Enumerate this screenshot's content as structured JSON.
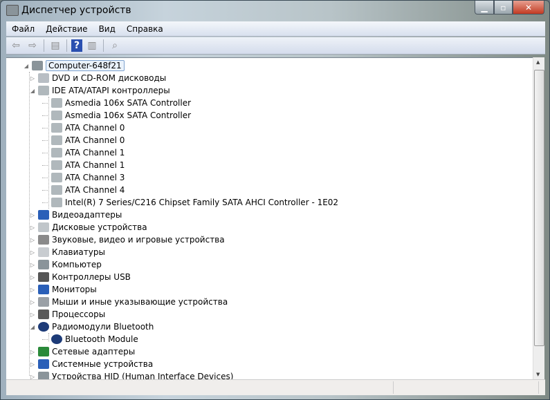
{
  "window": {
    "title": "Диспетчер устройств",
    "minimize": "▁",
    "maximize": "▫",
    "close": "✕"
  },
  "menu": [
    {
      "label": "Файл"
    },
    {
      "label": "Действие"
    },
    {
      "label": "Вид"
    },
    {
      "label": "Справка"
    }
  ],
  "toolbar": [
    {
      "name": "back-icon",
      "glyph": "⇦"
    },
    {
      "name": "forward-icon",
      "glyph": "⇨"
    },
    {
      "name": "sep"
    },
    {
      "name": "show-hide-console-tree-icon",
      "glyph": "▤"
    },
    {
      "name": "sep"
    },
    {
      "name": "help-icon",
      "glyph": "?"
    },
    {
      "name": "show-action-pane-icon",
      "glyph": "▥"
    },
    {
      "name": "sep"
    },
    {
      "name": "scan-hardware-icon",
      "glyph": "⌕"
    }
  ],
  "tree": [
    {
      "label": "Computer-648f21",
      "level": 0,
      "expanded": true,
      "icon": "computer-icon",
      "selected": true
    },
    {
      "label": "DVD и CD-ROM дисководы",
      "level": 1,
      "expanded": false,
      "icon": "dvd-drive-icon"
    },
    {
      "label": "IDE ATA/ATAPI контроллеры",
      "level": 1,
      "expanded": true,
      "icon": "ide-controller-icon"
    },
    {
      "label": "Asmedia 106x SATA Controller",
      "level": 2,
      "icon": "ide-controller-icon"
    },
    {
      "label": "Asmedia 106x SATA Controller",
      "level": 2,
      "icon": "ide-controller-icon"
    },
    {
      "label": "ATA Channel 0",
      "level": 2,
      "icon": "ide-controller-icon"
    },
    {
      "label": "ATA Channel 0",
      "level": 2,
      "icon": "ide-controller-icon"
    },
    {
      "label": "ATA Channel 1",
      "level": 2,
      "icon": "ide-controller-icon"
    },
    {
      "label": "ATA Channel 1",
      "level": 2,
      "icon": "ide-controller-icon"
    },
    {
      "label": "ATA Channel 3",
      "level": 2,
      "icon": "ide-controller-icon"
    },
    {
      "label": "ATA Channel 4",
      "level": 2,
      "icon": "ide-controller-icon"
    },
    {
      "label": "Intel(R) 7 Series/C216 Chipset Family SATA AHCI Controller - 1E02",
      "level": 2,
      "icon": "ide-controller-icon"
    },
    {
      "label": "Видеоадаптеры",
      "level": 1,
      "expanded": false,
      "icon": "display-adapter-icon"
    },
    {
      "label": "Дисковые устройства",
      "level": 1,
      "expanded": false,
      "icon": "disk-drive-icon"
    },
    {
      "label": "Звуковые, видео и игровые устройства",
      "level": 1,
      "expanded": false,
      "icon": "speaker-icon"
    },
    {
      "label": "Клавиатуры",
      "level": 1,
      "expanded": false,
      "icon": "keyboard-icon"
    },
    {
      "label": "Компьютер",
      "level": 1,
      "expanded": false,
      "icon": "computer-icon"
    },
    {
      "label": "Контроллеры USB",
      "level": 1,
      "expanded": false,
      "icon": "usb-icon"
    },
    {
      "label": "Мониторы",
      "level": 1,
      "expanded": false,
      "icon": "monitor-icon"
    },
    {
      "label": "Мыши и иные указывающие устройства",
      "level": 1,
      "expanded": false,
      "icon": "mouse-icon"
    },
    {
      "label": "Процессоры",
      "level": 1,
      "expanded": false,
      "icon": "processor-icon"
    },
    {
      "label": "Радиомодули Bluetooth",
      "level": 1,
      "expanded": true,
      "icon": "bluetooth-icon"
    },
    {
      "label": "Bluetooth Module",
      "level": 2,
      "icon": "bluetooth-icon"
    },
    {
      "label": "Сетевые адаптеры",
      "level": 1,
      "expanded": false,
      "icon": "network-adapter-icon"
    },
    {
      "label": "Системные устройства",
      "level": 1,
      "expanded": false,
      "icon": "system-devices-icon"
    },
    {
      "label": "Устройства HID (Human Interface Devices)",
      "level": 1,
      "expanded": false,
      "icon": "hid-icon"
    }
  ],
  "icon_colors": {
    "computer-icon": "#8a949a",
    "dvd-drive-icon": "#b8bec4",
    "ide-controller-icon": "#b0b8bc",
    "display-adapter-icon": "#2a5fb8",
    "disk-drive-icon": "#c0c6ca",
    "speaker-icon": "#8a8a8a",
    "keyboard-icon": "#c8ccd0",
    "usb-icon": "#555555",
    "monitor-icon": "#2a5fb8",
    "mouse-icon": "#9aa0a6",
    "processor-icon": "#5a5a5a",
    "bluetooth-icon": "#1d3b78",
    "network-adapter-icon": "#2a8a3a",
    "system-devices-icon": "#2a5fb8",
    "hid-icon": "#8a949a"
  }
}
